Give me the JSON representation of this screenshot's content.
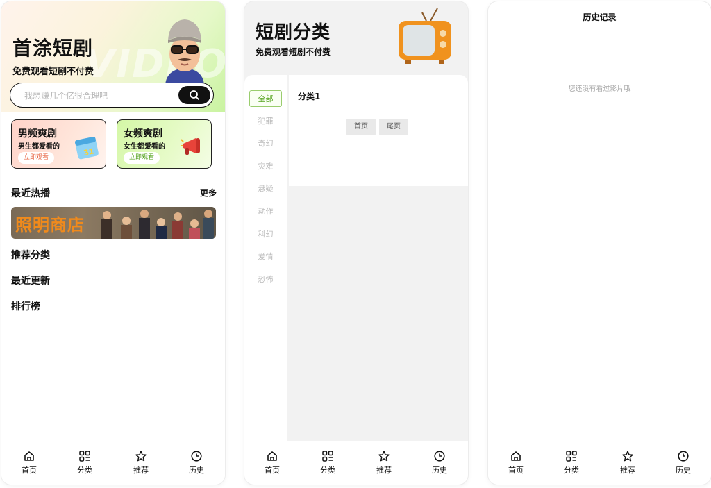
{
  "home": {
    "app_title": "首涂短剧",
    "subtitle": "免费观看短剧不付费",
    "watermark": "VIDEO",
    "search_placeholder": "我想赚几个亿很合理吧",
    "promo_male": {
      "title": "男频爽剧",
      "sub": "男生都爱看的",
      "button": "立即观看"
    },
    "promo_female": {
      "title": "女频爽剧",
      "sub": "女生都爱看的",
      "button": "立即观看"
    },
    "recent_hot": "最近热播",
    "more": "更多",
    "banner_text": "照明商店",
    "recommended": "推荐分类",
    "recent_updates": "最近更新",
    "ranking": "排行榜"
  },
  "category": {
    "title": "短剧分类",
    "subtitle": "免费观看短剧不付费",
    "items": [
      "全部",
      "犯罪",
      "奇幻",
      "灾难",
      "悬疑",
      "动作",
      "科幻",
      "爱情",
      "恐怖"
    ],
    "active_index": 0,
    "section": "分类1",
    "first_page": "首页",
    "last_page": "尾页"
  },
  "history": {
    "title": "历史记录",
    "empty": "您还没有看过影片哦"
  },
  "tabbar": {
    "home": "首页",
    "category": "分类",
    "recommend": "推荐",
    "history": "历史"
  },
  "colors": {
    "accent_green": "#52a21b",
    "male_promo": "#ffd3c9",
    "female_promo": "#d4f7a6",
    "banner_text": "#f08a1c"
  }
}
